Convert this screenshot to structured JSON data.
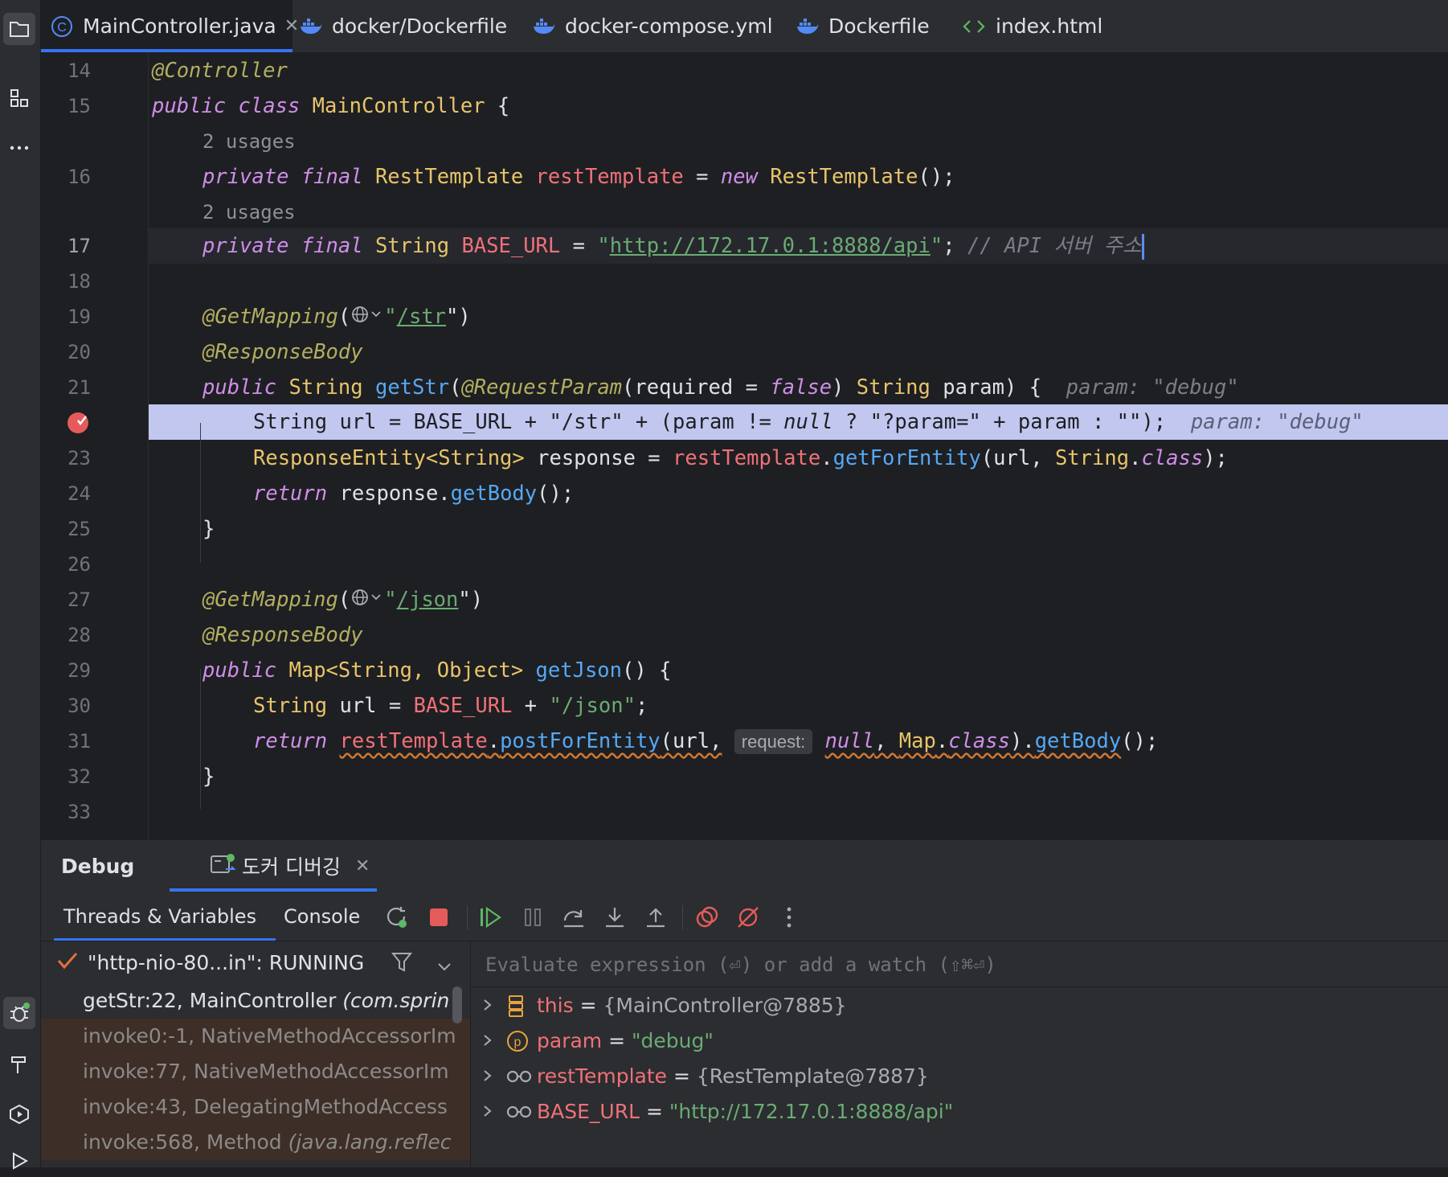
{
  "colors": {
    "accent": "#3574f0",
    "breakpoint": "#e55b5b",
    "background": "#1e1f22",
    "panel": "#2b2d30"
  },
  "tabs": [
    {
      "label": "MainController.java",
      "icon": "java-class-icon",
      "active": true,
      "closable": true
    },
    {
      "label": "docker/Dockerfile",
      "icon": "docker-icon"
    },
    {
      "label": "docker-compose.yml",
      "icon": "docker-icon"
    },
    {
      "label": "Dockerfile",
      "icon": "docker-icon"
    },
    {
      "label": "index.html",
      "icon": "html-icon"
    }
  ],
  "editor": {
    "line_numbers": [
      "14",
      "15",
      "16",
      "17",
      "18",
      "19",
      "20",
      "21",
      "23",
      "24",
      "25",
      "26",
      "27",
      "28",
      "29",
      "30",
      "31",
      "32",
      "33"
    ],
    "usages_hint": "2 usages",
    "l14": {
      "ann": "@Controller"
    },
    "l15": {
      "kw1": "public",
      "kw2": "class",
      "cls": "MainController",
      "tail": " {"
    },
    "l16": {
      "kw1": "private",
      "kw2": "final",
      "type": "RestTemplate",
      "field": "restTemplate",
      "eq": " = ",
      "kw3": "new",
      "ctor": "RestTemplate",
      "tail": "();"
    },
    "l17": {
      "kw1": "private",
      "kw2": "final",
      "type": "String",
      "field": "BASE_URL",
      "eq": " = ",
      "q1": "\"",
      "url": "http://172.17.0.1:8888/api",
      "q2": "\"",
      "semi": ";",
      "comment": "// API 서버 주소"
    },
    "l19": {
      "ann": "@GetMapping",
      "open": "(",
      "str_q": "\"",
      "path": "/str",
      "close": "\")"
    },
    "l20": {
      "ann": "@ResponseBody"
    },
    "l21": {
      "kw1": "public",
      "type": "String",
      "fn": "getStr",
      "open": "(",
      "ann": "@RequestParam",
      "p1": "(required = ",
      "kw2": "false",
      "p2": ") ",
      "type2": "String",
      "p3": " param) {",
      "hint": "param: \"debug\""
    },
    "l22": {
      "code": "String url = BASE_URL + \"/str\" + (param != ",
      "null_kw": "null",
      "code2": " ? \"?param=\" + param : \"\");",
      "hint": "param: \"debug\""
    },
    "l23": {
      "type": "ResponseEntity<String>",
      "p1": " response = ",
      "field": "restTemplate",
      "dot": ".",
      "fn": "getForEntity",
      "p2": "(url, ",
      "type2": "String",
      "dot2": ".",
      "kw": "class",
      "tail": ");"
    },
    "l24": {
      "kw": "return",
      "p1": " response.",
      "fn": "getBody",
      "tail": "();"
    },
    "l25": {
      "brace": "}"
    },
    "l27": {
      "ann": "@GetMapping",
      "open": "(",
      "str_q": "\"",
      "path": "/json",
      "close": "\")"
    },
    "l28": {
      "ann": "@ResponseBody"
    },
    "l29": {
      "kw1": "public",
      "type": "Map<String, Object>",
      "fn": "getJson",
      "tail": "() {"
    },
    "l30": {
      "type": "String",
      "p1": " url = ",
      "field": "BASE_URL",
      "p2": " + ",
      "str": "\"/json\"",
      "tail": ";"
    },
    "l31": {
      "kw": "return",
      "field": "restTemplate",
      "dot": ".",
      "fn": "postForEntity",
      "p1": "(url,",
      "inlay": "request:",
      "kw2": "null",
      "p2": ", ",
      "type": "Map",
      "dot2": ".",
      "kw3": "class",
      "p3": ").",
      "fn2": "getBody",
      "tail": "();"
    },
    "l32": {
      "brace": "}"
    }
  },
  "debug": {
    "panel_title": "Debug",
    "session_tab": "도커 디버깅",
    "subtabs": [
      "Threads & Variables",
      "Console"
    ],
    "thread": "\"http-nio-80...in\": RUNNING",
    "frames": [
      {
        "method": "getStr:22, MainController ",
        "pkg": "(com.sprin"
      },
      {
        "method": "invoke0:-1, NativeMethodAccessorIm",
        "pkg": ""
      },
      {
        "method": "invoke:77, NativeMethodAccessorIm",
        "pkg": ""
      },
      {
        "method": "invoke:43, DelegatingMethodAccess",
        "pkg": ""
      },
      {
        "method": "invoke:568, Method ",
        "pkg": "(java.lang.reflec"
      }
    ],
    "eval_placeholder": "Evaluate expression (⏎) or add a watch (⇧⌘⏎)",
    "variables": [
      {
        "name": "this",
        "eq": " = ",
        "value": "{MainController@7885}",
        "icon": "object-icon"
      },
      {
        "name": "param",
        "eq": " = ",
        "value": "\"debug\"",
        "icon": "parameter-icon"
      },
      {
        "name": "restTemplate",
        "eq": " = ",
        "value": "{RestTemplate@7887}",
        "icon": "field-watch-icon"
      },
      {
        "name": "BASE_URL",
        "eq": " = ",
        "value": "\"http://172.17.0.1:8888/api\"",
        "icon": "field-watch-icon"
      }
    ]
  }
}
